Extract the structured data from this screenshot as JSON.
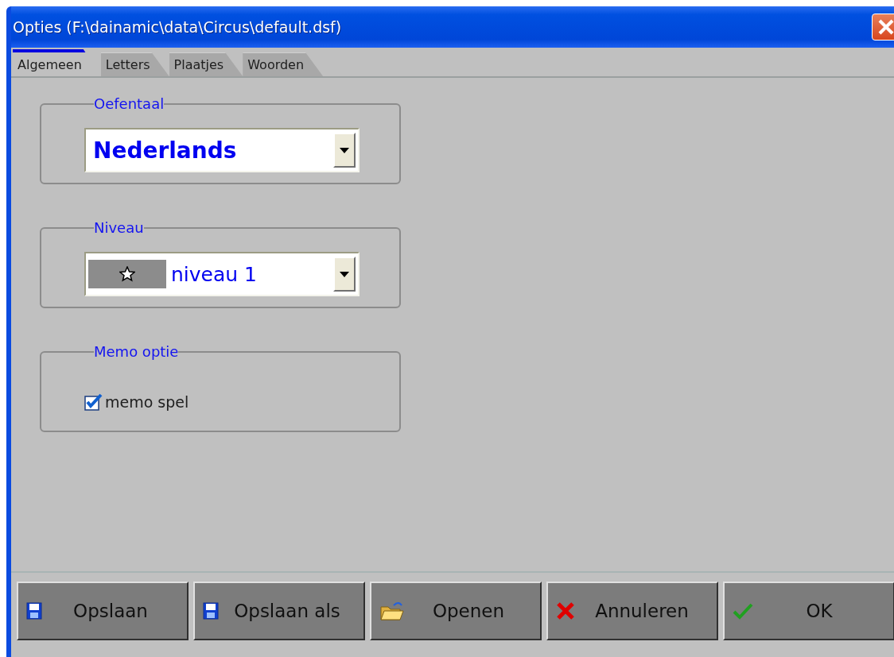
{
  "window": {
    "title": "Opties (F:\\dainamic\\data\\Circus\\default.dsf)"
  },
  "tabs": [
    {
      "label": "Algemeen",
      "selected": true
    },
    {
      "label": "Letters",
      "selected": false
    },
    {
      "label": "Plaatjes",
      "selected": false
    },
    {
      "label": "Woorden",
      "selected": false
    }
  ],
  "groups": [
    {
      "kind": "select",
      "legend": "Oefentaal",
      "value": "Nederlands"
    },
    {
      "kind": "level-select",
      "legend": "Niveau",
      "value": "niveau 1"
    },
    {
      "kind": "checkbox",
      "legend": "Memo optie",
      "label": "memo spel",
      "checked": true
    }
  ],
  "buttons": [
    {
      "kind": "save",
      "label": "Opslaan"
    },
    {
      "kind": "save",
      "label": "Opslaan als"
    },
    {
      "kind": "open",
      "label": "Openen"
    },
    {
      "kind": "cancel",
      "label": "Annuleren"
    },
    {
      "kind": "ok",
      "label": "OK"
    }
  ]
}
